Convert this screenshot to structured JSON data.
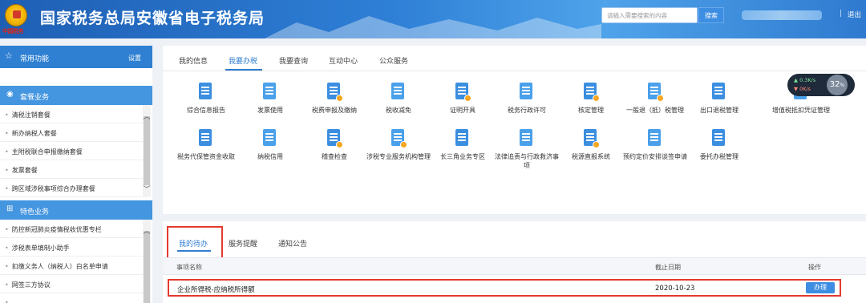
{
  "header": {
    "site_title": "国家税务总局安徽省电子税务局",
    "seal_text": "中国税务",
    "search_placeholder": "请输入需要搜索的内容",
    "search_button": "搜索",
    "separator": "|",
    "logout": "退出",
    "accent_color": "#2e7fd6"
  },
  "sidebar": {
    "common": {
      "label": "常用功能",
      "settings": "设置"
    },
    "sections": [
      {
        "label": "套餐业务",
        "items": [
          "清税注销套餐",
          "新办纳税人套餐",
          "主附税联合申报缴纳套餐",
          "发票套餐",
          "跨区域涉税事项综合办理套餐"
        ]
      },
      {
        "label": "特色业务",
        "items": [
          "防控新冠肺炎疫情税收优惠专栏",
          "涉税表单填制小助手",
          "扣缴义务人（纳税人）白名单申请",
          "网签三方协议",
          "..."
        ]
      }
    ]
  },
  "main": {
    "tabs": [
      "我的信息",
      "我要办税",
      "我要查询",
      "互动中心",
      "公众服务"
    ],
    "active_tab": "我要办税",
    "grid_row1": [
      "综合信息报告",
      "发票使用",
      "税费申报及缴纳",
      "税收减免",
      "证明开具",
      "税务行政许可",
      "核定管理",
      "一般退（抵）税管理",
      "出口退税管理",
      "增值税抵扣凭证管理"
    ],
    "grid_row2": [
      "税务代保管资金收取",
      "纳税信用",
      "稽查检查",
      "涉税专业服务机构管理",
      "长三角业务专区",
      "法律追责与行政救济事项",
      "税源直报系统",
      "预约定价安排谈签申请",
      "委托办税管理"
    ]
  },
  "speed_widget": {
    "up": "0.3K/s",
    "down": "0K/s",
    "percent": "32",
    "unit": "%"
  },
  "todo": {
    "tabs": [
      "我的待办",
      "服务提醒",
      "通知公告"
    ],
    "active_tab": "我的待办",
    "columns": {
      "name": "事项名称",
      "deadline": "截止日期",
      "action": "操作"
    },
    "rows": [
      {
        "name": "企业所得税-应纳税所得额",
        "deadline": "2020-10-23",
        "action": "办理"
      }
    ],
    "highlight_color": "#e43a2f"
  }
}
